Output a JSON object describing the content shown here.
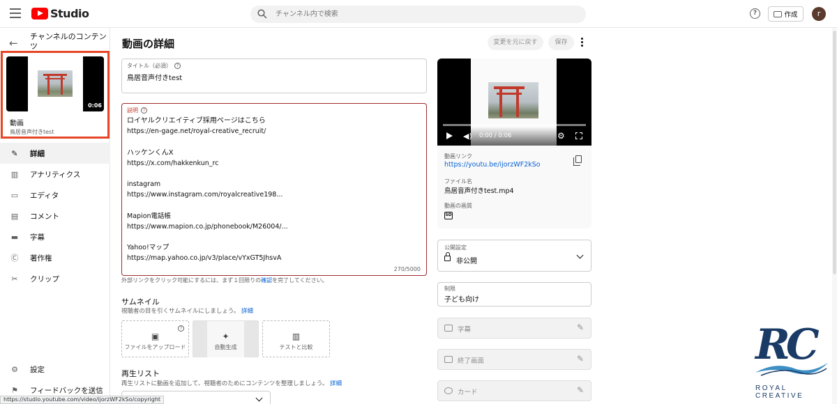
{
  "app": {
    "name": "Studio"
  },
  "search": {
    "placeholder": "チャンネル内で検索"
  },
  "header": {
    "create_label": "作成",
    "avatar_initial": "r"
  },
  "sidebar": {
    "back_title": "チャンネルのコンテンツ",
    "video_card": {
      "duration": "0:06",
      "label": "動画",
      "title": "鳥居音声付きtest"
    },
    "items": [
      {
        "label": "詳細",
        "icon": "pencil-icon",
        "active": true
      },
      {
        "label": "アナリティクス",
        "icon": "analytics-icon"
      },
      {
        "label": "エディタ",
        "icon": "editor-icon"
      },
      {
        "label": "コメント",
        "icon": "comment-icon"
      },
      {
        "label": "字幕",
        "icon": "subtitles-icon"
      },
      {
        "label": "著作権",
        "icon": "copyright-icon"
      },
      {
        "label": "クリップ",
        "icon": "scissors-icon"
      }
    ],
    "bottom_items": [
      {
        "label": "設定",
        "icon": "gear-icon"
      },
      {
        "label": "フィードバックを送信",
        "icon": "feedback-icon"
      }
    ]
  },
  "main": {
    "page_title": "動画の詳細",
    "undo_label": "変更を元に戻す",
    "save_label": "保存",
    "title_field": {
      "label": "タイトル（必須）",
      "value": "鳥居音声付きtest"
    },
    "description": {
      "label": "説明",
      "lines": [
        "ロイヤルクリエイティブ採用ページはこちら",
        "https://en-gage.net/royal-creative_recruit/",
        "",
        "ハッケンくんX",
        "https://x.com/hakkenkun_rc",
        "",
        "instagram",
        "https://www.instagram.com/royalcreative198...",
        "",
        "Mapion電話帳",
        "https://www.mapion.co.jp/phonebook/M26004/...",
        "",
        "Yahoo!マップ",
        "https://map.yahoo.co.jp/v3/place/vYxGT5JhsvA"
      ],
      "counter": "270/5000"
    },
    "external_note_prefix": "外部リンクをクリック可能にするには、まず１回限りの",
    "external_note_link": "確認",
    "external_note_suffix": "を完了してください。",
    "thumbnail": {
      "title": "サムネイル",
      "subtitle": "視聴者の目を引くサムネイルにしましょう。",
      "detail_link": "詳細",
      "upload_label": "ファイルをアップロード",
      "auto_label": "自動生成",
      "compare_label": "テストと比較"
    },
    "playlist": {
      "title": "再生リスト",
      "subtitle": "再生リストに動画を追加して、視聴者のためにコンテンツを整理しましょう。",
      "detail_link": "詳細"
    }
  },
  "right": {
    "player": {
      "time": "0:00 / 0:06"
    },
    "video_link_label": "動画リンク",
    "video_link": "https://youtu.be/ijorzWF2kSo",
    "filename_label": "ファイル名",
    "filename": "鳥居音声付きtest.mp4",
    "quality_label": "動画の画質",
    "quality_badge": "SD",
    "visibility": {
      "label": "公開設定",
      "value": "非公開"
    },
    "restriction": {
      "label": "制限",
      "value": "子ども向け"
    },
    "subtitles_label": "字幕",
    "endscreen_label": "終了画面",
    "cards_label": "カード"
  },
  "brand": {
    "mark": "RC",
    "name": "ROYAL CREATIVE"
  },
  "status_url": "https://studio.youtube.com/video/ijorzWF2kSo/copyright",
  "colors": {
    "brand_red": "#ff0000",
    "highlight": "#e64626",
    "link": "#065fd4",
    "logo_navy": "#1a3b66"
  }
}
